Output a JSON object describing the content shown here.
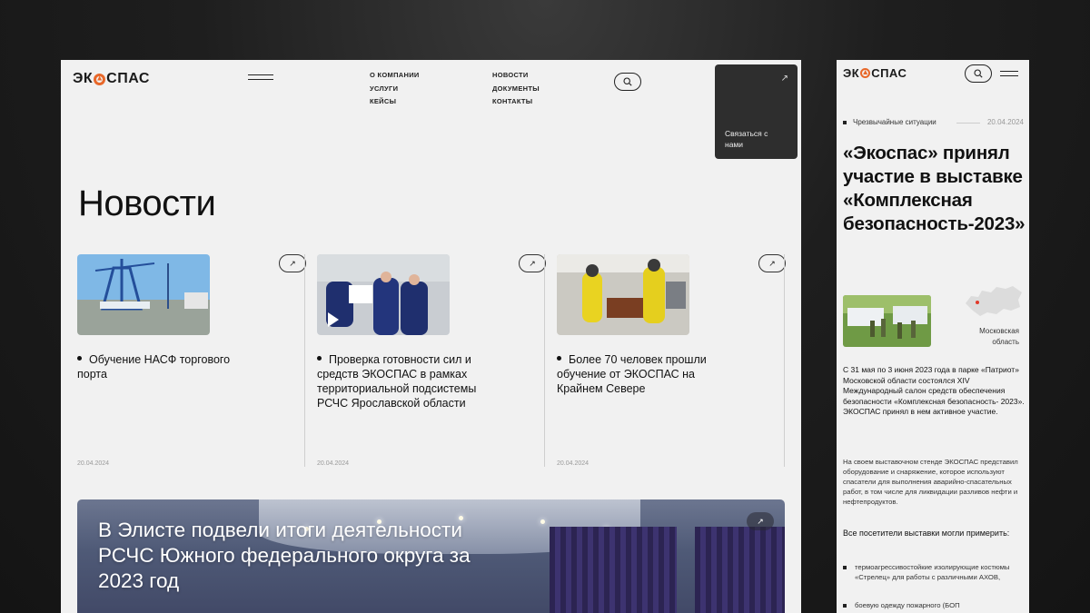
{
  "brand": {
    "logo_prefix": "ЭК",
    "logo_suffix": "СПАС",
    "accent": "#e8682a"
  },
  "desktop": {
    "nav_col1": [
      "О КОМПАНИИ",
      "УСЛУГИ",
      "КЕЙСЫ"
    ],
    "nav_col2": [
      "НОВОСТИ",
      "ДОКУМЕНТЫ",
      "КОНТАКТЫ"
    ],
    "contact_label": "Связаться с нами",
    "page_title": "Новости",
    "cards": [
      {
        "title": "Обучение НАСФ торгового порта",
        "date": "20.04.2024"
      },
      {
        "title": "Проверка готовности сил и средств ЭКОСПАС в рамках территориальной подсистемы РСЧС Ярославской области",
        "date": "20.04.2024"
      },
      {
        "title": "Более 70 человек прошли обучение от ЭКОСПАС на Крайнем Севере",
        "date": "20.04.2024"
      }
    ],
    "hero_title": "В Элисте подвели итоги деятельности РСЧС Южного федерального округа за 2023 год"
  },
  "mobile": {
    "category": "Чрезвычайные ситуации",
    "date": "20.04.2024",
    "title": "«Экоспас» принял участие в выставке «Комплексная безопасность-2023»",
    "region": "Московская область",
    "para1": "С 31 мая по 3 июня 2023 года в парке «Патриот» Московской области состоялся XIV Международный салон средств обеспечения безопасности «Комплексная безопасность- 2023». ЭКОСПАС принял в нем активное участие.",
    "para2": "На своем выставочном стенде ЭКОСПАС представил оборудование и снаряжение, которое используют спасатели для выполнения аварийно-спасательных работ, в том числе для ликвидации разливов нефти и нефтепродуктов.",
    "para3": "Все посетители выставки могли примерить:",
    "list": [
      "термоагрессивостойкие изолирующие костюмы «Стрелец» для работы с различными АХОВ,",
      "боевую одежду пожарного (БОП"
    ]
  }
}
